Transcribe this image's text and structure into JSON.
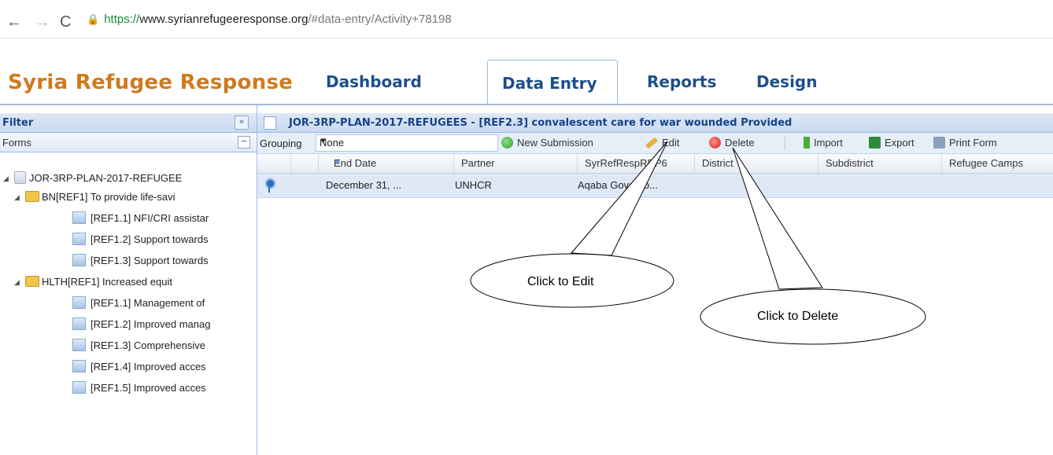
{
  "browser": {
    "back_glyph": "←",
    "forward_glyph": "→",
    "reload_glyph": "C",
    "url_scheme": "https://",
    "url_host": "www.syrianrefugeeresponse.org",
    "url_path": "/#data-entry/Activity+78198"
  },
  "app": {
    "brand": "Syria Refugee Response",
    "tabs": [
      "Dashboard",
      "Data Entry",
      "Reports",
      "Design"
    ],
    "active_tab": "Data Entry",
    "brand_color": "#d07a1a",
    "tab_color": "#1d4f8c"
  },
  "filter_panel": {
    "title": "Filter",
    "forms_label": "Forms",
    "tree": [
      "JOR-3RP-PLAN-2017-REFUGEE",
      "BN[REF1] To provide life-savi",
      "[REF1.1] NFI/CRI assistar",
      "[REF1.2] Support towards",
      "[REF1.3] Support towards",
      "HLTH[REF1] Increased equit",
      "[REF1.1] Management of",
      "[REF1.2] Improved manag",
      "[REF1.3] Comprehensive",
      "[REF1.4] Improved acces",
      "[REF1.5] Improved acces"
    ]
  },
  "grid": {
    "title": "JOR-3RP-PLAN-2017-REFUGEES - [REF2.3] convalescent care for war wounded Provided",
    "toolbar": {
      "grouping_label": "Grouping",
      "grouping_value": "None",
      "new_submission": "New Submission",
      "edit": "Edit",
      "delete": "Delete",
      "import": "Import",
      "export": "Export",
      "print_form": "Print Form"
    },
    "columns": [
      "End Date",
      "Partner",
      "SyrRefRespRRP6",
      "District",
      "Subdistrict",
      "Refugee Camps"
    ],
    "rows": [
      {
        "end_date": "December 31, ...",
        "partner": "UNHCR",
        "location": "Aqaba Governo..."
      }
    ]
  },
  "callouts": {
    "edit": "Click to Edit",
    "delete": "Click to Delete"
  }
}
